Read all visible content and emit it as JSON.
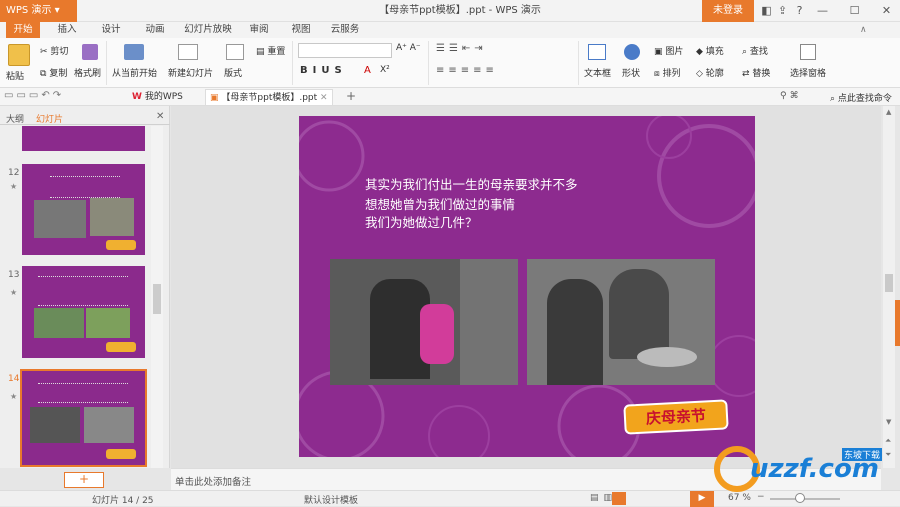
{
  "app": {
    "name": "WPS 演示",
    "login_label": "未登录"
  },
  "document": {
    "title": "【母亲节ppt模板】.ppt - WPS 演示"
  },
  "menu_tabs": [
    "开始",
    "插入",
    "设计",
    "动画",
    "幻灯片放映",
    "审阅",
    "视图",
    "云服务"
  ],
  "ribbon": {
    "cut": "剪切",
    "copy": "复制",
    "format_painter": "格式刷",
    "paste": "粘贴",
    "from_current": "从当前开始",
    "new_slide": "新建幻灯片",
    "layout": "版式",
    "reset": "重置",
    "textbox": "文本框",
    "shape": "形状",
    "arrange": "排列",
    "outline": "轮廓",
    "picture": "图片",
    "fill": "填充",
    "find": "查找",
    "replace": "替换",
    "select_pane": "选择窗格"
  },
  "doc_tabs": {
    "my_wps": "我的WPS",
    "current": "【母亲节ppt模板】.ppt"
  },
  "search_cmd": "点此查找命令",
  "left_pane": {
    "outline_tab": "大纲",
    "slides_tab": "幻灯片"
  },
  "thumbnails": [
    {
      "num": "12"
    },
    {
      "num": "13"
    },
    {
      "num": "14"
    }
  ],
  "slide": {
    "lines": [
      "其实为我们付出一生的母亲要求并不多",
      "想想她曾为我们做过的事情",
      "我们为她做过几件？"
    ],
    "logo_text": "庆母亲节"
  },
  "notes_placeholder": "单击此处添加备注",
  "status": {
    "slide_info": "幻灯片 14 / 25",
    "template": "默认设计模板",
    "zoom": "67 %"
  },
  "watermark": {
    "text": "uzzf.com",
    "sub": "东坡下载"
  },
  "colors": {
    "accent": "#e8792c",
    "slide_bg": "#8d2b8f"
  }
}
